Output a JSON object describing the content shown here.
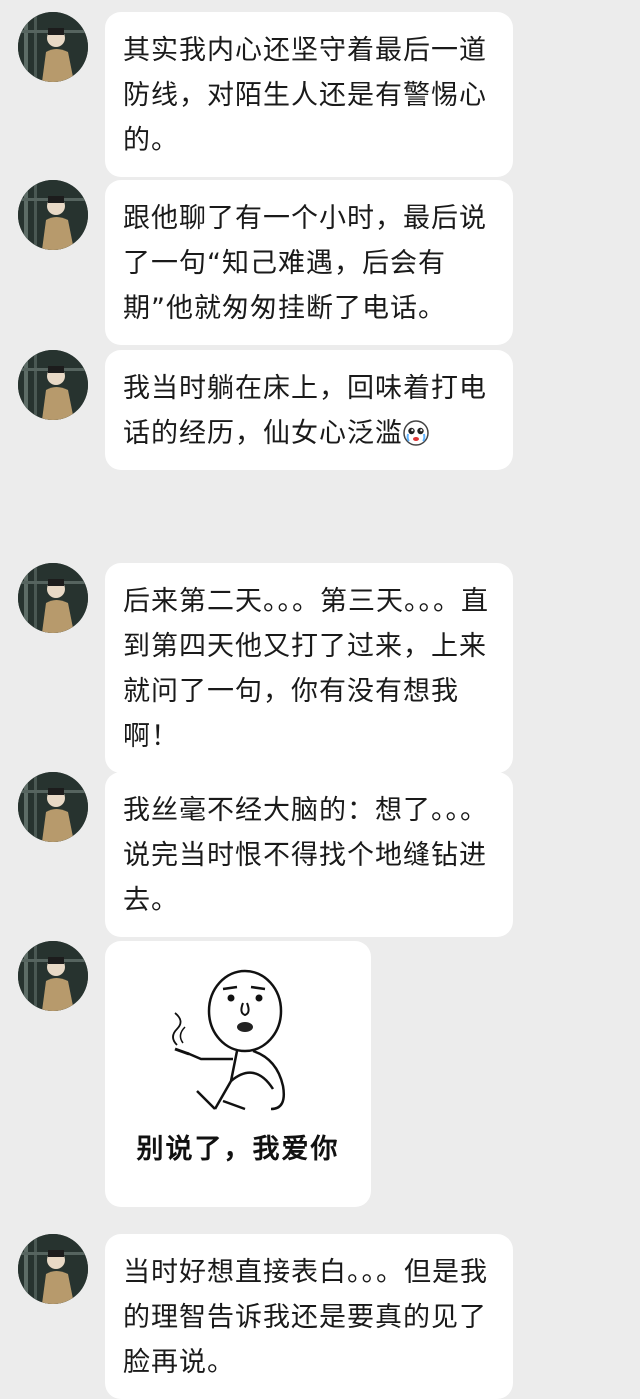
{
  "messages": [
    {
      "text": "其实我内心还坚守着最后一道防线，对陌生人还是有警惕心的。"
    },
    {
      "text": "跟他聊了有一个小时，最后说了一句“知己难遇，后会有期”他就匆匆挂断了电话。"
    },
    {
      "text": "我当时躺在床上，回味着打电话的经历，仙女心泛滥",
      "emoji": "crying-face-emoji"
    },
    {
      "text": "后来第二天。。。第三天。。。直到第四天他又打了过来，上来就问了一句，你有没有想我啊！"
    },
    {
      "text": "我丝毫不经大脑的：想了。。。说完当时恨不得找个地缝钻进去。"
    },
    {
      "sticker_caption": "别说了，我爱你",
      "sticker_icon": "smoking-meme-figure"
    },
    {
      "text": "当时好想直接表白。。。但是我的理智告诉我还是要真的见了脸再说。"
    }
  ],
  "colors": {
    "background": "#ececec",
    "bubble": "#ffffff",
    "text": "#1a1a1a"
  }
}
